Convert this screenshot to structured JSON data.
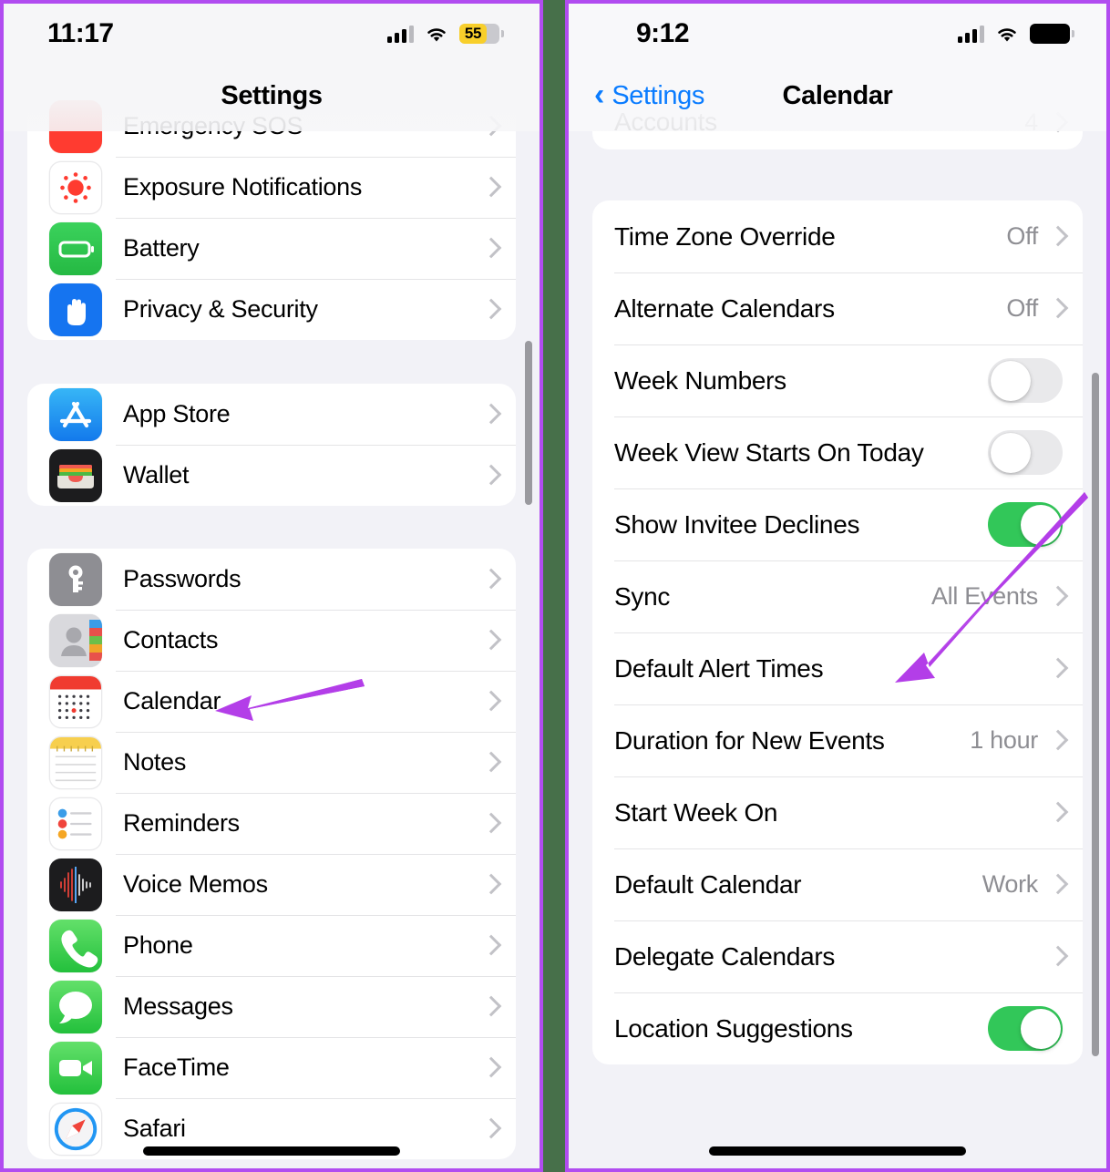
{
  "theme": {
    "panel_border": "#b14cf0",
    "gap_background": "#47704a",
    "accent_blue": "#0a7cff",
    "toggle_on": "#32c759",
    "annotation_arrow": "#b14cf0",
    "page_background": "#f2f2f7"
  },
  "left_phone": {
    "status_bar": {
      "time": "11:17",
      "battery_percent": "55",
      "battery_state": "low-power-yellow",
      "signal_icon": "cellular-bars-icon",
      "wifi_icon": "wifi-icon"
    },
    "nav": {
      "title": "Settings"
    },
    "groups": [
      {
        "id": "system-group",
        "clipped_top": true,
        "rows": [
          {
            "label": "Emergency SOS",
            "icon": "sos-icon",
            "accessory": "chevron"
          },
          {
            "label": "Exposure Notifications",
            "icon": "exposure-notifications-icon",
            "accessory": "chevron"
          },
          {
            "label": "Battery",
            "icon": "battery-icon",
            "accessory": "chevron"
          },
          {
            "label": "Privacy & Security",
            "icon": "privacy-security-icon",
            "accessory": "chevron"
          }
        ]
      },
      {
        "id": "store-group",
        "rows": [
          {
            "label": "App Store",
            "icon": "app-store-icon",
            "accessory": "chevron"
          },
          {
            "label": "Wallet",
            "icon": "wallet-icon",
            "accessory": "chevron"
          }
        ]
      },
      {
        "id": "apps-group",
        "rows": [
          {
            "label": "Passwords",
            "icon": "passwords-icon",
            "accessory": "chevron"
          },
          {
            "label": "Contacts",
            "icon": "contacts-icon",
            "accessory": "chevron"
          },
          {
            "label": "Calendar",
            "icon": "calendar-icon",
            "accessory": "chevron",
            "highlighted": true
          },
          {
            "label": "Notes",
            "icon": "notes-icon",
            "accessory": "chevron"
          },
          {
            "label": "Reminders",
            "icon": "reminders-icon",
            "accessory": "chevron"
          },
          {
            "label": "Voice Memos",
            "icon": "voice-memos-icon",
            "accessory": "chevron"
          },
          {
            "label": "Phone",
            "icon": "phone-icon",
            "accessory": "chevron"
          },
          {
            "label": "Messages",
            "icon": "messages-icon",
            "accessory": "chevron"
          },
          {
            "label": "FaceTime",
            "icon": "facetime-icon",
            "accessory": "chevron"
          },
          {
            "label": "Safari",
            "icon": "safari-icon",
            "accessory": "chevron"
          }
        ]
      }
    ]
  },
  "right_phone": {
    "status_bar": {
      "time": "9:12",
      "battery_state": "full-black",
      "signal_icon": "cellular-bars-icon",
      "wifi_icon": "wifi-icon"
    },
    "nav": {
      "back_label": "Settings",
      "back_icon": "chevron-left-icon",
      "title": "Calendar"
    },
    "groups": [
      {
        "id": "accounts-group",
        "clipped_top": true,
        "rows": [
          {
            "label": "Accounts",
            "value": "4",
            "accessory": "chevron"
          }
        ]
      },
      {
        "id": "calendar-options-group",
        "rows": [
          {
            "label": "Time Zone Override",
            "value": "Off",
            "accessory": "chevron"
          },
          {
            "label": "Alternate Calendars",
            "value": "Off",
            "accessory": "chevron"
          },
          {
            "label": "Week Numbers",
            "accessory": "toggle",
            "toggle": "off"
          },
          {
            "label": "Week View Starts On Today",
            "accessory": "toggle",
            "toggle": "off"
          },
          {
            "label": "Show Invitee Declines",
            "accessory": "toggle",
            "toggle": "on"
          },
          {
            "label": "Sync",
            "value": "All Events",
            "accessory": "chevron"
          },
          {
            "label": "Default Alert Times",
            "accessory": "chevron",
            "highlighted": true
          },
          {
            "label": "Duration for New Events",
            "value": "1 hour",
            "accessory": "chevron"
          },
          {
            "label": "Start Week On",
            "accessory": "chevron"
          },
          {
            "label": "Default Calendar",
            "value": "Work",
            "accessory": "chevron"
          },
          {
            "label": "Delegate Calendars",
            "accessory": "chevron"
          },
          {
            "label": "Location Suggestions",
            "accessory": "toggle",
            "toggle": "on"
          }
        ]
      }
    ]
  },
  "annotations": [
    {
      "id": "arrow-to-calendar",
      "target": "Calendar",
      "direction": "right-to-left"
    },
    {
      "id": "arrow-to-default-alert-times",
      "target": "Default Alert Times",
      "direction": "upper-right-to-lower-left"
    }
  ]
}
